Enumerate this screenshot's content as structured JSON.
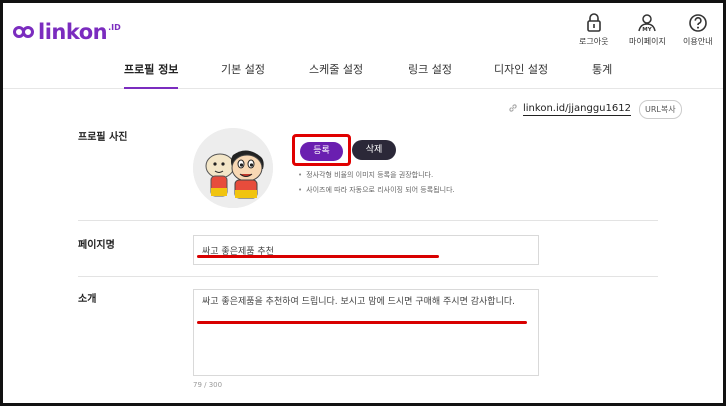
{
  "brand": {
    "name": "linkon",
    "suffix": ".ID"
  },
  "header_actions": [
    {
      "name": "logout",
      "label": "로그아웃"
    },
    {
      "name": "mypage",
      "label": "마이페이지"
    },
    {
      "name": "guide",
      "label": "이용안내"
    }
  ],
  "tabs": [
    {
      "label": "프로필 정보",
      "active": true
    },
    {
      "label": "기본 설정",
      "active": false
    },
    {
      "label": "스케줄 설정",
      "active": false
    },
    {
      "label": "링크 설정",
      "active": false
    },
    {
      "label": "디자인 설정",
      "active": false
    },
    {
      "label": "통계",
      "active": false
    }
  ],
  "url": {
    "value": "linkon.id/jjanggu1612",
    "copy_label": "URL복사"
  },
  "profile_photo": {
    "label": "프로필 사진",
    "register_label": "등록",
    "delete_label": "삭제",
    "hints": [
      "정사각형 비율의 이미지 등록을 권장합니다.",
      "사이즈에 따라 자동으로 리사이징 되어 등록됩니다."
    ]
  },
  "page_name": {
    "label": "페이지명",
    "value": "싸고 좋은제품 추천"
  },
  "intro": {
    "label": "소개",
    "value": "싸고 좋은제품을 추천하여 드립니다. 보시고 맘에 드시면 구매해 주시면 감사합니다.",
    "counter": "79 / 300"
  },
  "colors": {
    "accent": "#7b2cbf",
    "highlight": "#e00000",
    "dark_button": "#2b2838"
  },
  "icons": [
    "link-icon",
    "lock-icon",
    "user-icon",
    "question-icon"
  ]
}
